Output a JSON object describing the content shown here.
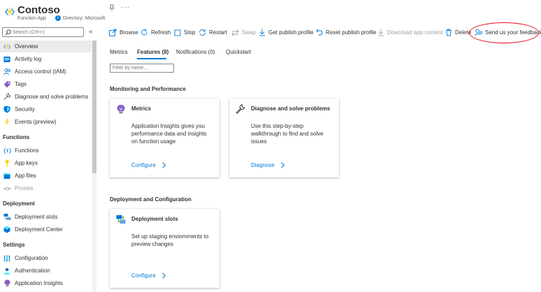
{
  "header": {
    "title": "Contoso",
    "subtitle": "Function App",
    "directory": "Directory: Microsoft"
  },
  "search": {
    "placeholder": "Search (Ctrl+/)"
  },
  "sidebar": {
    "items": [
      {
        "label": "Overview",
        "icon": "lightning-icon",
        "selected": true
      },
      {
        "label": "Activity log",
        "icon": "activity-log-icon"
      },
      {
        "label": "Access control (IAM)",
        "icon": "people-icon"
      },
      {
        "label": "Tags",
        "icon": "tag-icon"
      },
      {
        "label": "Diagnose and solve problems",
        "icon": "wrench-icon"
      },
      {
        "label": "Security",
        "icon": "shield-icon"
      },
      {
        "label": "Events (preview)",
        "icon": "lightning-icon"
      }
    ],
    "sections": [
      {
        "header": "Functions",
        "items": [
          {
            "label": "Functions",
            "icon": "functions-icon"
          },
          {
            "label": "App keys",
            "icon": "key-icon"
          },
          {
            "label": "App files",
            "icon": "files-icon"
          },
          {
            "label": "Proxies",
            "icon": "proxy-icon",
            "disabled": true
          }
        ]
      },
      {
        "header": "Deployment",
        "items": [
          {
            "label": "Deployment slots",
            "icon": "slots-icon"
          },
          {
            "label": "Deployment Center",
            "icon": "cube-icon"
          }
        ]
      },
      {
        "header": "Settings",
        "items": [
          {
            "label": "Configuration",
            "icon": "sliders-icon"
          },
          {
            "label": "Authentication",
            "icon": "person-icon"
          },
          {
            "label": "Application Insights",
            "icon": "bulb-icon"
          }
        ]
      }
    ]
  },
  "toolbar": {
    "browse": "Browse",
    "refresh": "Refresh",
    "stop": "Stop",
    "restart": "Restart",
    "swap": "Swap",
    "get_publish_profile": "Get publish profile",
    "reset_publish_profile": "Reset publish profile",
    "download_app_content": "Download app content",
    "delete": "Delete",
    "feedback": "Send us your feedback"
  },
  "tabs": [
    {
      "label": "Metrics"
    },
    {
      "label": "Features (8)",
      "active": true
    },
    {
      "label": "Notifications (0)"
    },
    {
      "label": "Quickstart"
    }
  ],
  "filter": {
    "placeholder": "Filter by name..."
  },
  "groups": {
    "monitoring": "Monitoring and Performance",
    "deployment": "Deployment and Configuration"
  },
  "cards": {
    "metrics": {
      "title": "Metrics",
      "description": "Application Insights gives you performance data and insights on function usage",
      "link": "Configure",
      "icon": "bulb-icon"
    },
    "diagnose": {
      "title": "Diagnose and solve problems",
      "description": "Use this step-by-step walkthrough to find and solve issues",
      "link": "Diagnose",
      "icon": "wrench-icon"
    },
    "slots": {
      "title": "Deployment slots",
      "description": "Set up staging enviornments to preview changes",
      "link": "Configure",
      "icon": "slots-icon"
    }
  },
  "colors": {
    "accent": "#0078d4",
    "annotation": "#e81123",
    "selected_bg": "#edebe9"
  }
}
